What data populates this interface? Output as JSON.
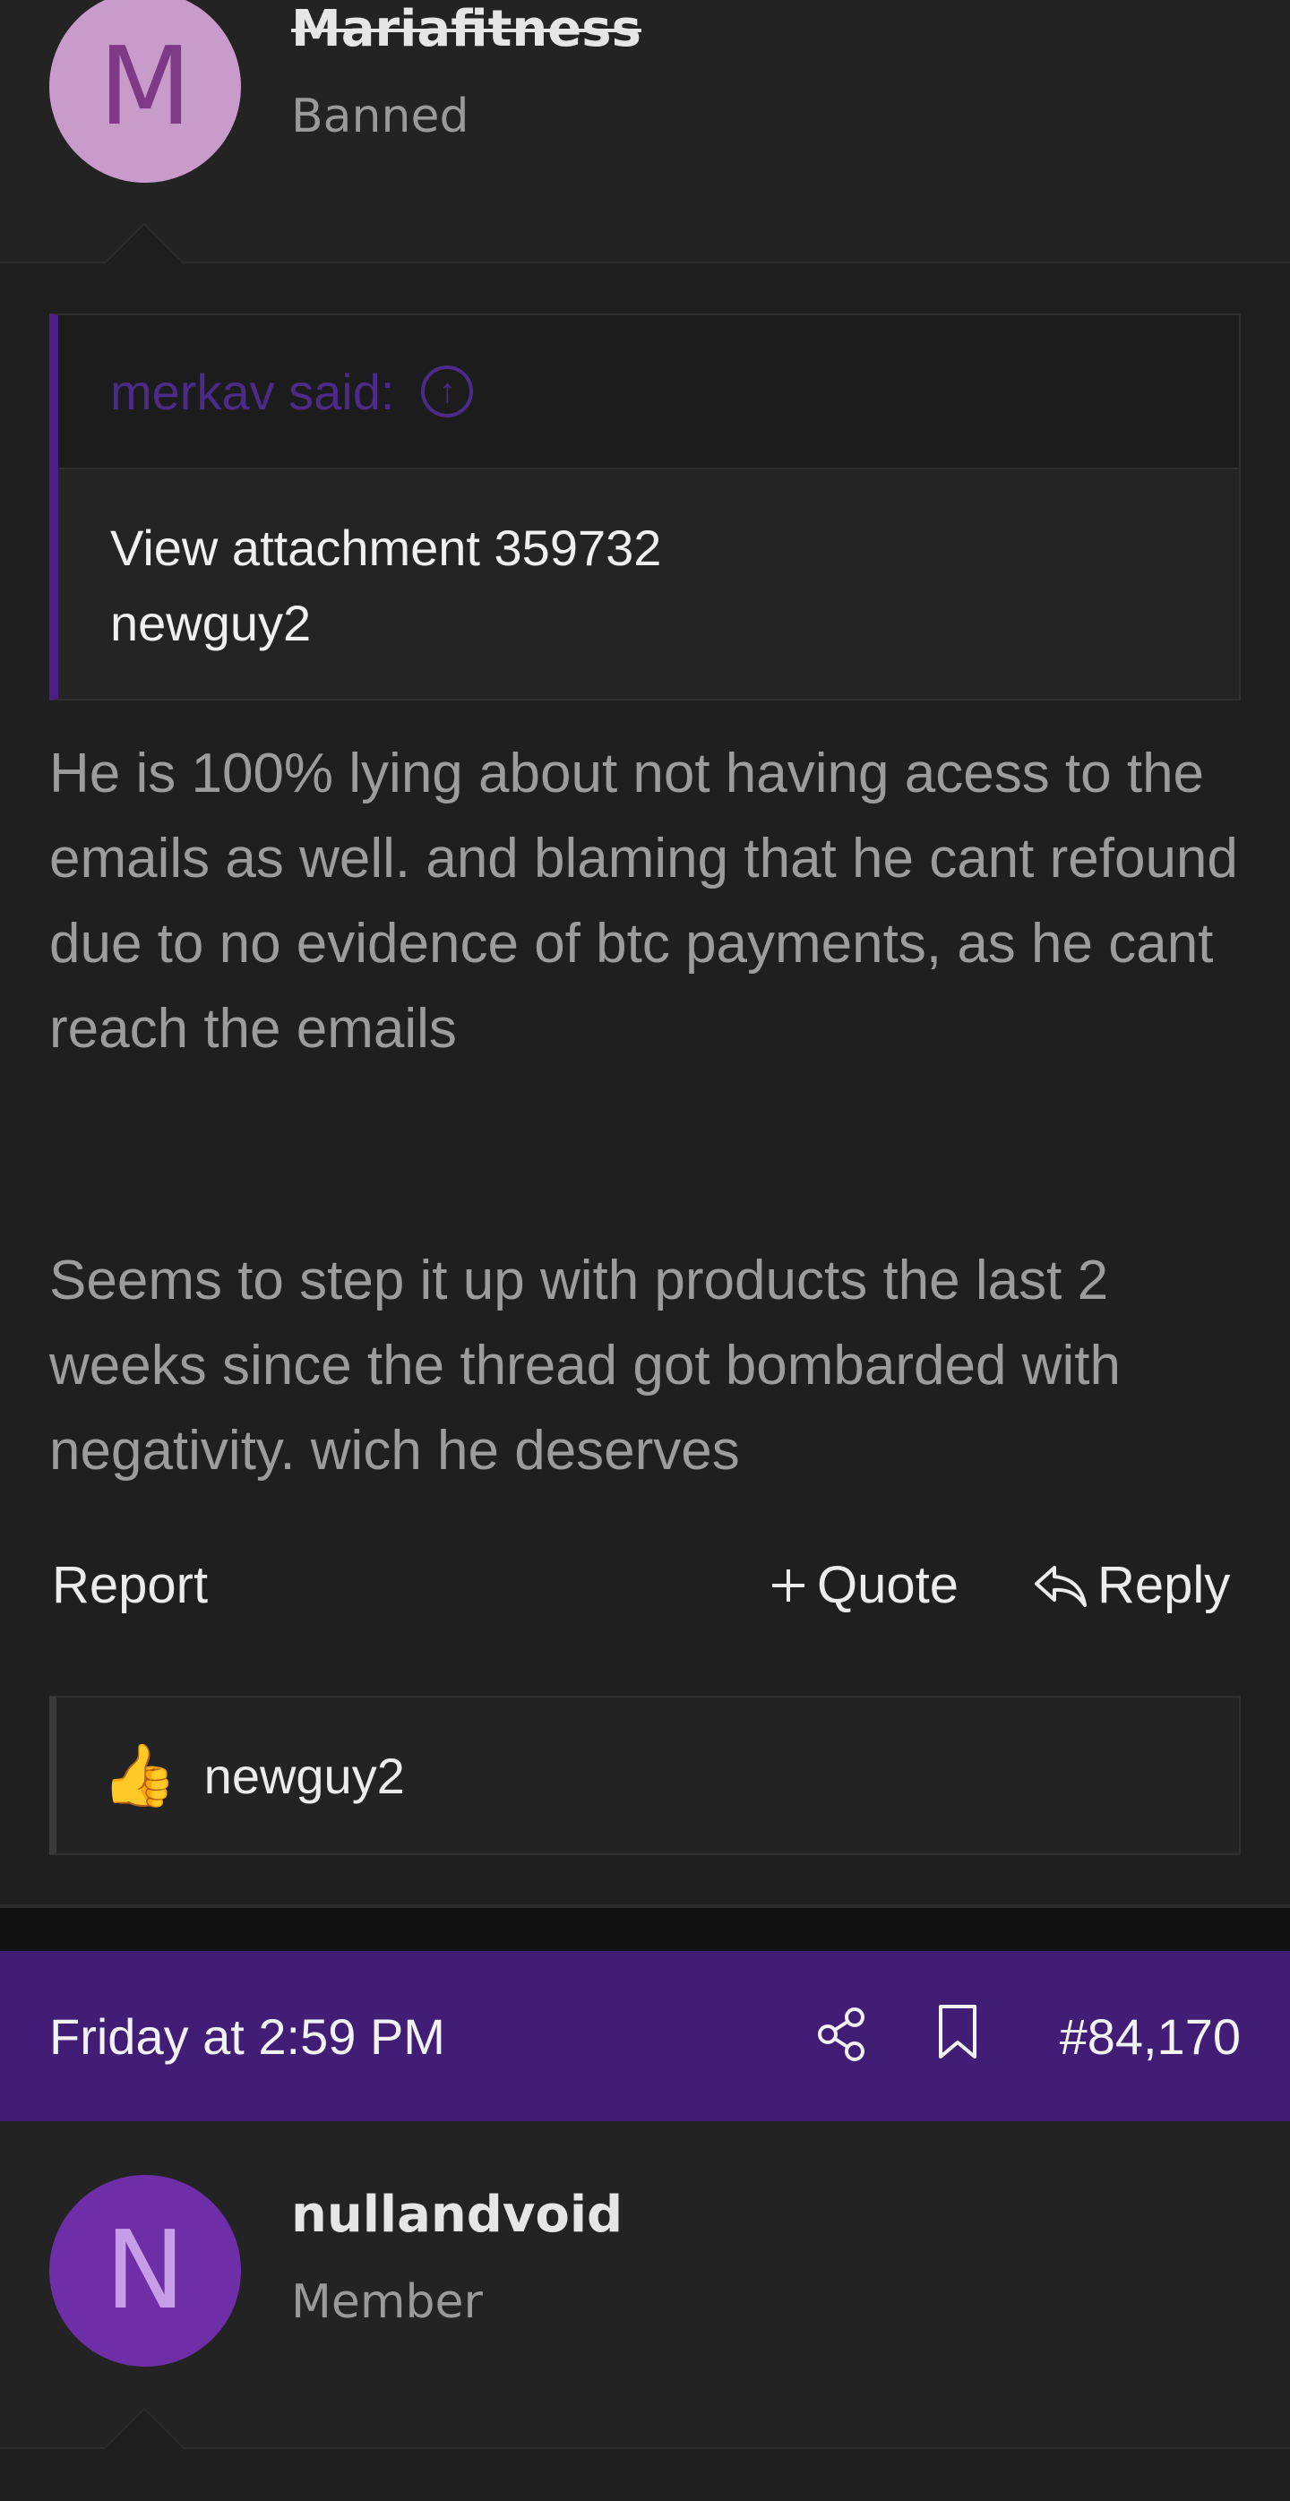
{
  "post1": {
    "avatar_letter": "M",
    "username": "Mariafitness",
    "user_title": "Banned",
    "quote": {
      "author_label": "merkav said:",
      "lines": [
        "View attachment 359732",
        "newguy2"
      ]
    },
    "message_paragraphs": [
      "He is 100% lying about not having acess to the emails as well. and blaming that he cant refound due to no evidence of btc payments, as he cant reach the emails",
      "Seems to step it up with products the last 2 weeks since the thread got bombarded with negativity. wich he deserves"
    ],
    "actions": {
      "report": "Report",
      "quote": "Quote",
      "reply": "Reply"
    },
    "reactions": {
      "users": "newguy2",
      "icon": "thumbs-up"
    }
  },
  "post2": {
    "date": "Friday at 2:59 PM",
    "post_number": "#84,170",
    "avatar_letter": "N",
    "username": "nullandvoid",
    "user_title": "Member"
  },
  "colors": {
    "accent": "#421d75",
    "quote_border": "#4b1f85",
    "background": "#1f1f1f"
  }
}
